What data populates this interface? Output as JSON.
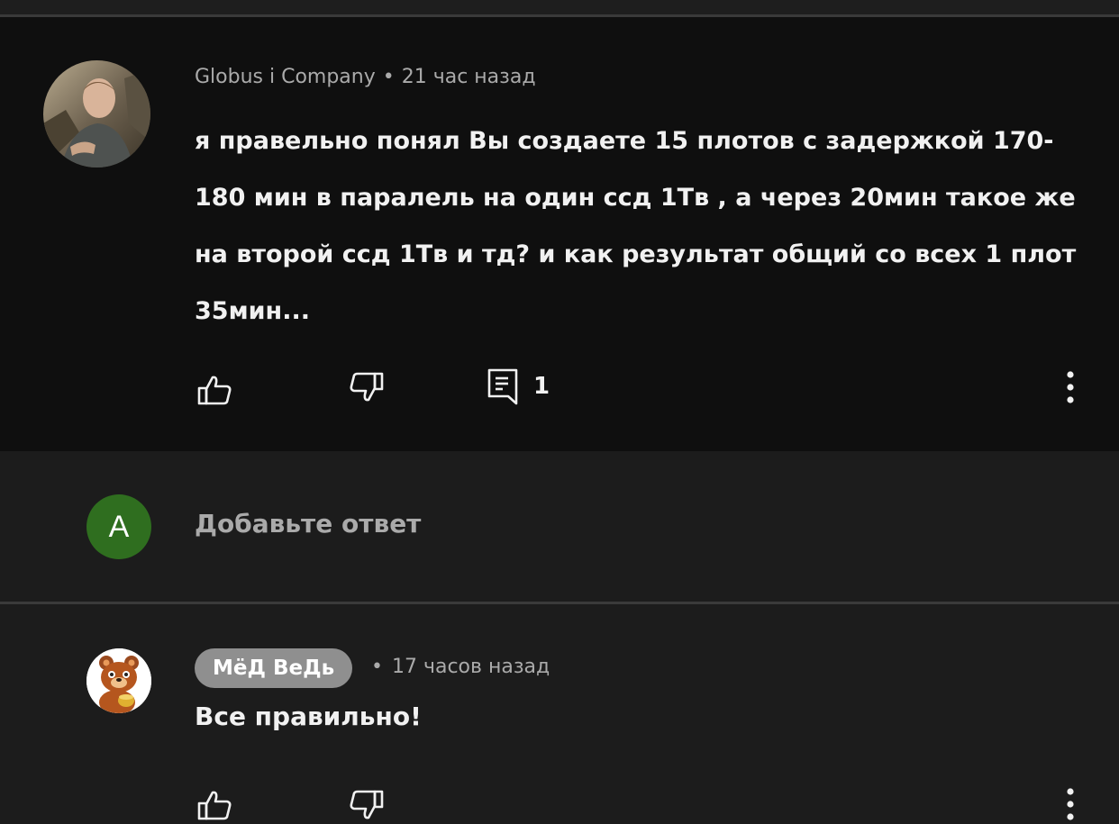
{
  "comment": {
    "author": "Globus i Company",
    "separator": "•",
    "time": "21 час назад",
    "text": "я правельно понял Вы создаете 15 плотов с задержкой 170-180 мин в паралель на один ссд 1Тв , а через 20мин такое же на второй ссд 1Тв и тд? и как результат общий со всех 1 плот 35мин...",
    "reply_count": "1",
    "icons": [
      "thumb-up-icon",
      "thumb-down-icon",
      "reply-icon",
      "more-vert-icon"
    ]
  },
  "reply_box": {
    "avatar_letter": "A",
    "avatar_color": "#2f6e1f",
    "placeholder": "Добавьте ответ"
  },
  "reply": {
    "author": "МёД ВеДь",
    "separator": "•",
    "time": "17 часов назад",
    "text": "Все правильно!",
    "icons": [
      "thumb-up-icon",
      "thumb-down-icon",
      "more-vert-icon"
    ]
  },
  "colors": {
    "background": "#1c1c1c",
    "comment_background": "#0f0f0f",
    "text": "#f1f1f1",
    "secondary_text": "#aaaaaa",
    "author_chip": "#8f8f8f"
  }
}
